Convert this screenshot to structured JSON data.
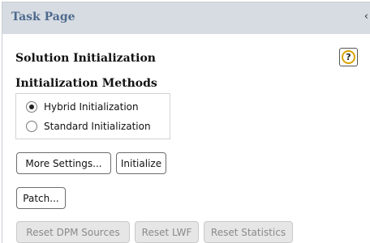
{
  "panel": {
    "title": "Task Page",
    "collapse_icon": "‹"
  },
  "section": {
    "title": "Solution Initialization",
    "help_icon": "?"
  },
  "init_methods": {
    "title": "Initialization Methods",
    "options": [
      {
        "label": "Hybrid  Initialization",
        "selected": true
      },
      {
        "label": "Standard Initialization",
        "selected": false
      }
    ]
  },
  "buttons": {
    "more_settings": "More Settings...",
    "initialize": "Initialize",
    "patch": "Patch...",
    "reset_dpm": "Reset DPM Sources",
    "reset_lwf": "Reset LWF",
    "reset_statistics": "Reset Statistics"
  }
}
